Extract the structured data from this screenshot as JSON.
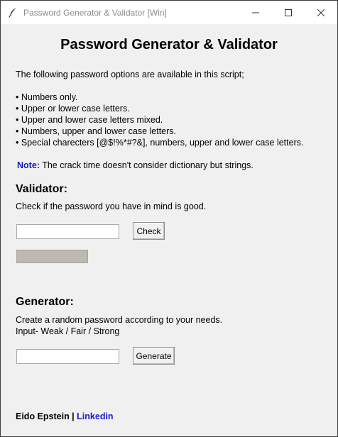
{
  "window": {
    "title": "Password Generator & Validator [Win]"
  },
  "heading": "Password Generator & Validator",
  "intro": "The following password options are available in this script;",
  "options": [
    "• Numbers only.",
    "• Upper or lower case letters.",
    "• Upper and lower case letters mixed.",
    "• Numbers, upper and lower case letters.",
    "• Special charecters [@$!%*#?&], numbers, upper and lower case letters."
  ],
  "note": {
    "label": "Note:",
    "text": "The crack time doesn't consider dictionary but strings."
  },
  "validator": {
    "title": "Validator:",
    "description": "Check if the password you have in mind is good.",
    "input_value": "",
    "button_label": "Check"
  },
  "generator": {
    "title": "Generator:",
    "description_line1": "Create a random password according to your needs.",
    "description_line2": "Input- Weak / Fair / Strong",
    "input_value": "",
    "button_label": "Generate"
  },
  "footer": {
    "author": "Eido Epstein |",
    "link_label": "Linkedin"
  },
  "colors": {
    "accent": "#1a1acc",
    "background": "#f0f0f0",
    "strength_bar": "#bdb9b2"
  },
  "icons": {
    "app": "feather-quill-icon",
    "minimize": "minimize-icon",
    "maximize": "maximize-icon",
    "close": "close-icon"
  }
}
